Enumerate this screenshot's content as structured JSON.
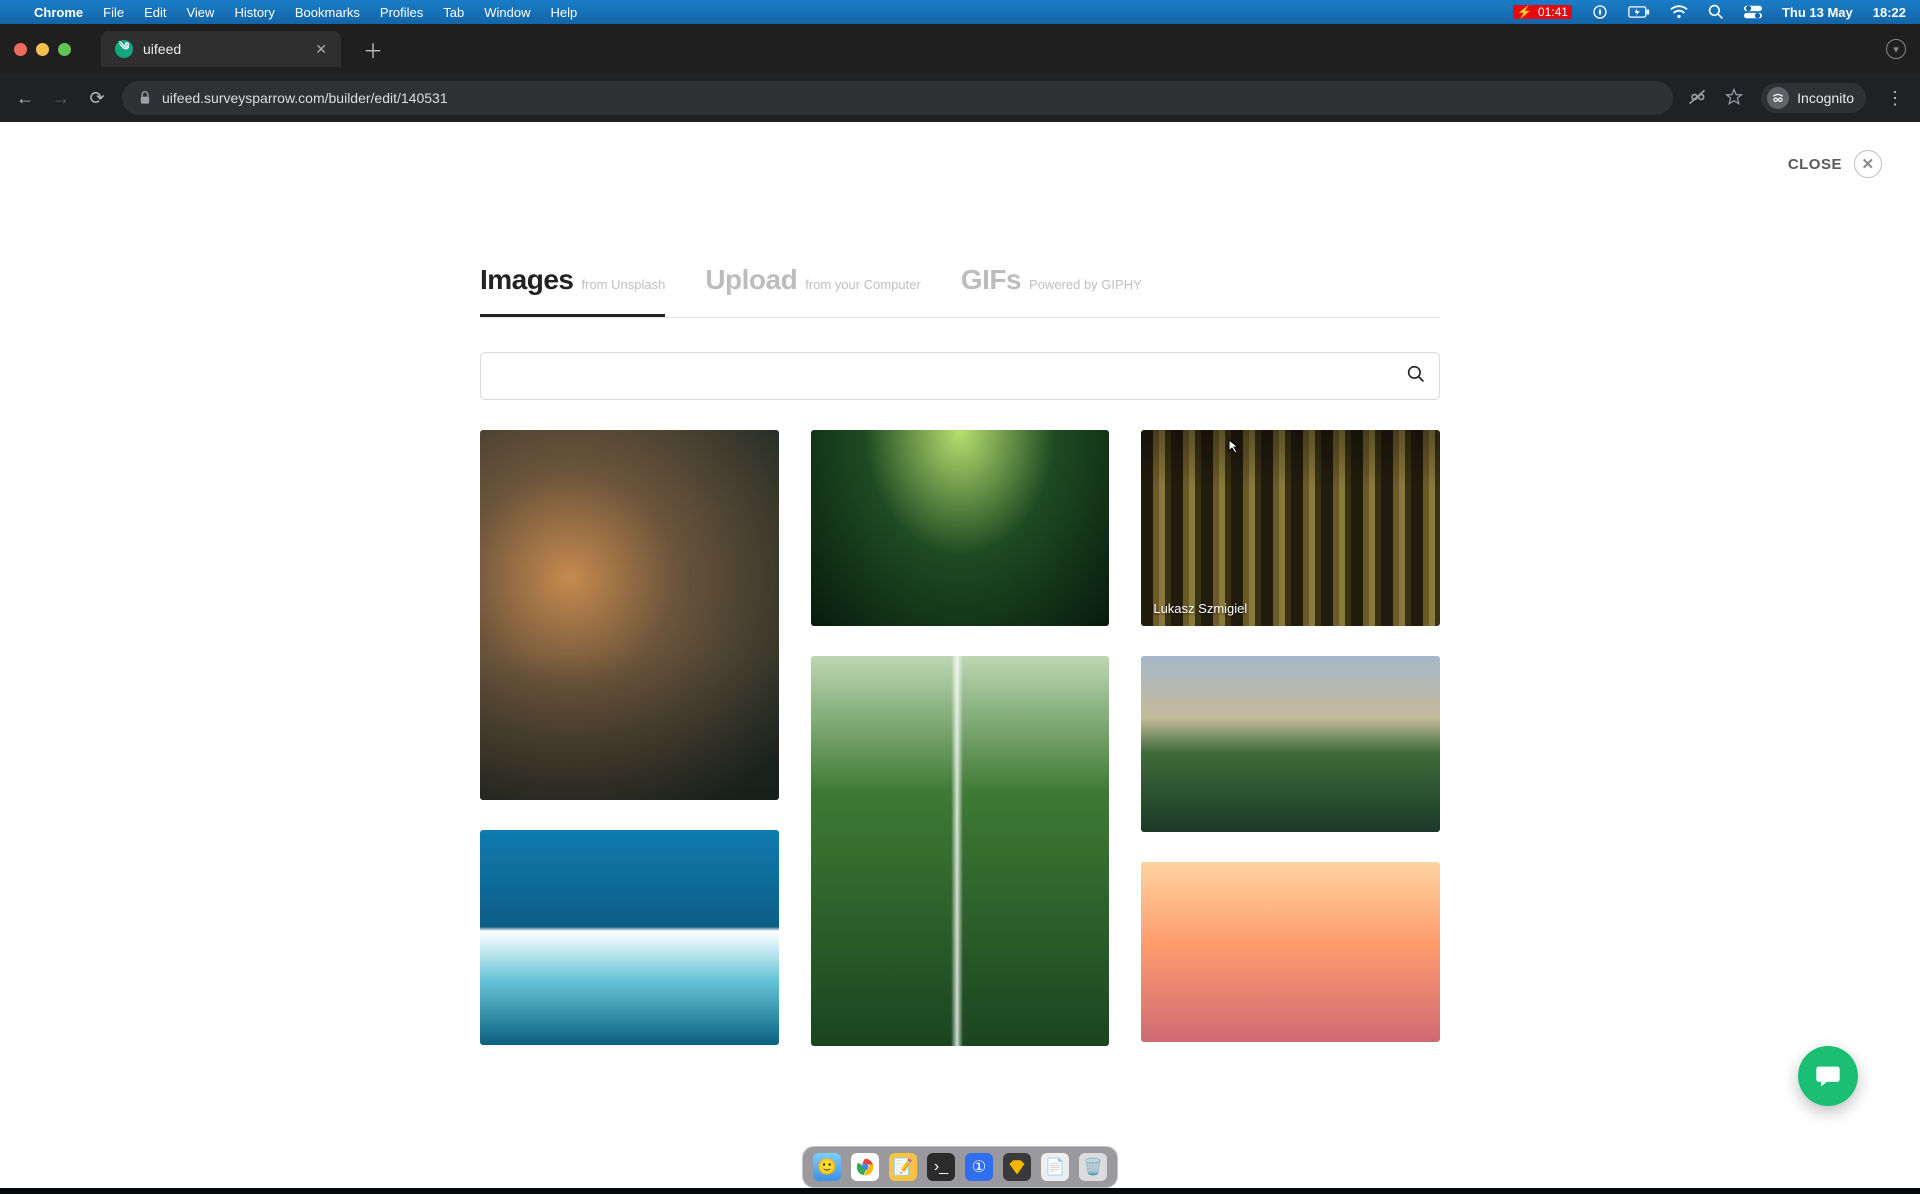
{
  "menubar": {
    "apple": "",
    "app": "Chrome",
    "items": [
      "File",
      "Edit",
      "View",
      "History",
      "Bookmarks",
      "Profiles",
      "Tab",
      "Window",
      "Help"
    ],
    "battery": "01:41",
    "date": "Thu 13 May",
    "time": "18:22"
  },
  "browser": {
    "tab_title": "uifeed",
    "url": "uifeed.surveysparrow.com/builder/edit/140531",
    "incognito": "Incognito"
  },
  "modal": {
    "close": "CLOSE",
    "tabs": {
      "images_l": "Images",
      "images_s": "from Unsplash",
      "upload_l": "Upload",
      "upload_s": "from your Computer",
      "gifs_l": "GIFs",
      "gifs_s": "Powered by GIPHY"
    },
    "search": {
      "value": "",
      "placeholder": ""
    },
    "credits": {
      "g5": "Lukasz Szmigiel"
    }
  },
  "dock": {
    "apps": [
      "finder",
      "chrome",
      "notes",
      "terminal",
      "onepassword",
      "sketch",
      "textedit",
      "trash"
    ]
  }
}
